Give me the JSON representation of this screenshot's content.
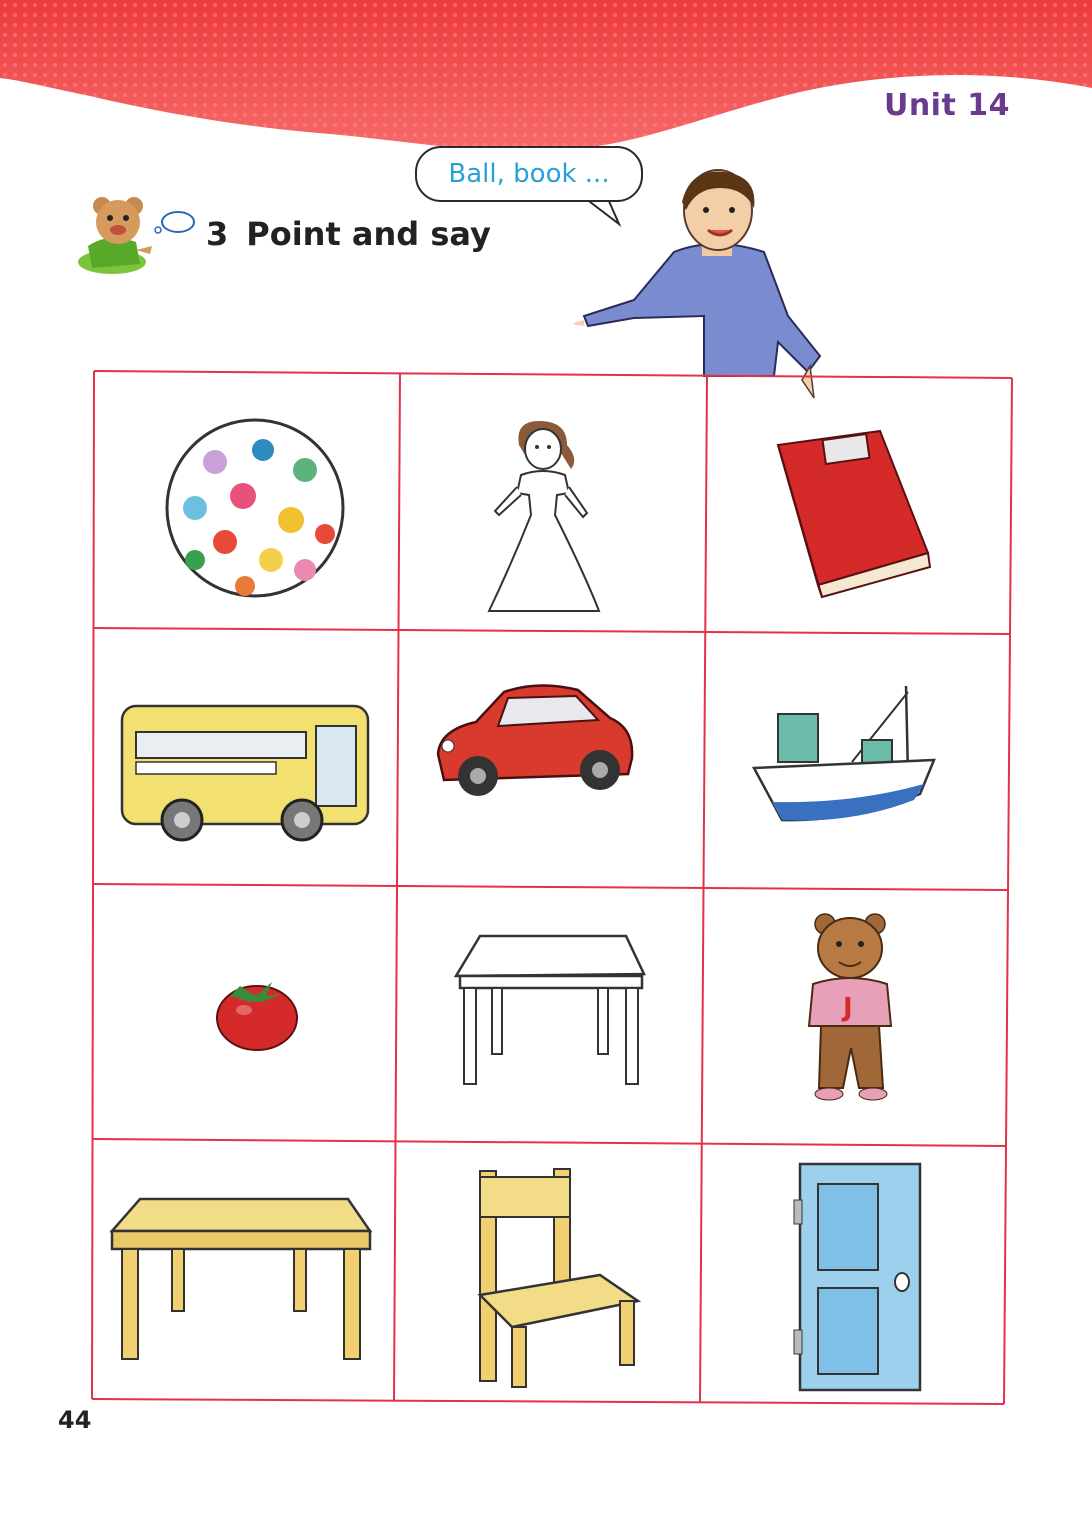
{
  "header": {
    "unit_title": "Unit 14"
  },
  "speech_bubble": {
    "text": "Ball, book ..."
  },
  "activity": {
    "number": "3",
    "title": "Point and say"
  },
  "grid": {
    "items": [
      {
        "icon": "ball-icon"
      },
      {
        "icon": "doll-icon"
      },
      {
        "icon": "book-icon"
      },
      {
        "icon": "bus-icon"
      },
      {
        "icon": "car-icon"
      },
      {
        "icon": "boat-icon"
      },
      {
        "icon": "tomato-icon"
      },
      {
        "icon": "table-icon"
      },
      {
        "icon": "teddy-bear-icon"
      },
      {
        "icon": "desk-icon"
      },
      {
        "icon": "chair-icon"
      },
      {
        "icon": "door-icon"
      }
    ]
  },
  "footer": {
    "page_number": "44"
  },
  "colors": {
    "banner": "#f04a4a",
    "grid_line": "#e2324a",
    "unit_title": "#6a3a8e",
    "bubble_text": "#2aa0d8"
  }
}
